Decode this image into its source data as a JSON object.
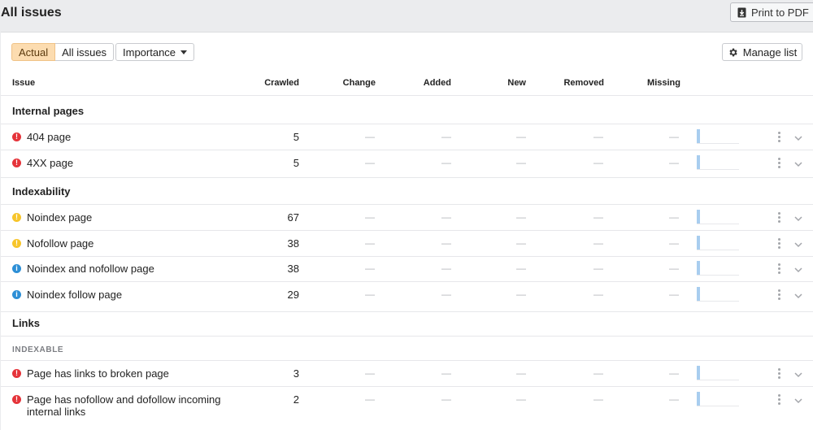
{
  "header": {
    "title": "All issues",
    "print_label": "Print to PDF"
  },
  "filters": {
    "actual_label": "Actual",
    "all_issues_label": "All issues",
    "importance_label": "Importance",
    "manage_label": "Manage list"
  },
  "columns": {
    "issue": "Issue",
    "crawled": "Crawled",
    "change": "Change",
    "added": "Added",
    "new": "New",
    "removed": "Removed",
    "missing": "Missing"
  },
  "dash": "—",
  "sections": [
    {
      "title": "Internal pages",
      "rows": [
        {
          "severity": "error",
          "label": "404 page",
          "crawled": "5"
        },
        {
          "severity": "error",
          "label": "4XX page",
          "crawled": "5"
        }
      ]
    },
    {
      "title": "Indexability",
      "rows": [
        {
          "severity": "warning",
          "label": "Noindex page",
          "crawled": "67"
        },
        {
          "severity": "warning",
          "label": "Nofollow page",
          "crawled": "38"
        },
        {
          "severity": "notice",
          "label": "Noindex and nofollow page",
          "crawled": "38"
        },
        {
          "severity": "notice",
          "label": "Noindex follow page",
          "crawled": "29"
        }
      ]
    },
    {
      "title": "Links",
      "subtitle": "INDEXABLE",
      "rows": [
        {
          "severity": "error",
          "label": "Page has links to broken page",
          "crawled": "3"
        },
        {
          "severity": "error",
          "label": "Page has nofollow and dofollow incoming internal links",
          "crawled": "2"
        }
      ]
    }
  ],
  "colors": {
    "error": "#e5343a",
    "warning": "#f7c52b",
    "notice": "#2d8fd6",
    "accent": "#fcdcb0"
  }
}
